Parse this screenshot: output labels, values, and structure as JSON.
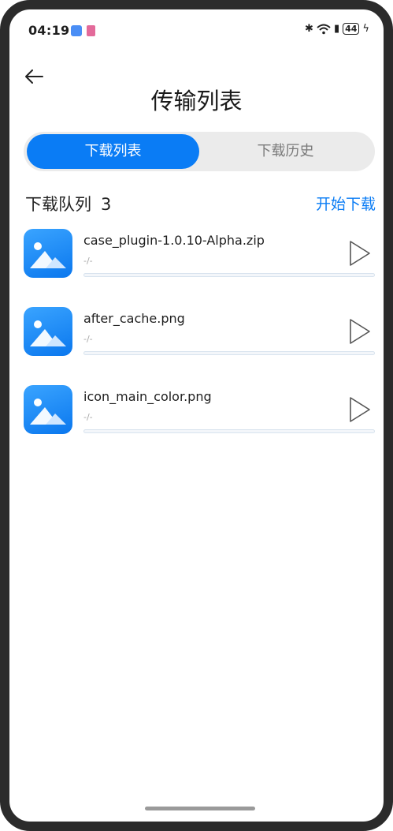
{
  "status_bar": {
    "time": "04:19",
    "battery": "44",
    "icons": [
      "usb-icon",
      "app-notification-icon",
      "bluetooth-icon",
      "wifi-icon",
      "charging-icon"
    ]
  },
  "header": {
    "title": "传输列表"
  },
  "tabs": [
    {
      "label": "下载列表",
      "active": true
    },
    {
      "label": "下载历史",
      "active": false
    }
  ],
  "queue": {
    "label": "下载队列",
    "count": "3",
    "start_label": "开始下载"
  },
  "items": [
    {
      "name": "case_plugin-1.0.10-Alpha.zip",
      "progress_text": "-/-",
      "progress": 0
    },
    {
      "name": "after_cache.png",
      "progress_text": "-/-",
      "progress": 0
    },
    {
      "name": "icon_main_color.png",
      "progress_text": "-/-",
      "progress": 0
    }
  ],
  "colors": {
    "accent": "#0a7cf5",
    "segment_bg": "#ebebeb"
  }
}
